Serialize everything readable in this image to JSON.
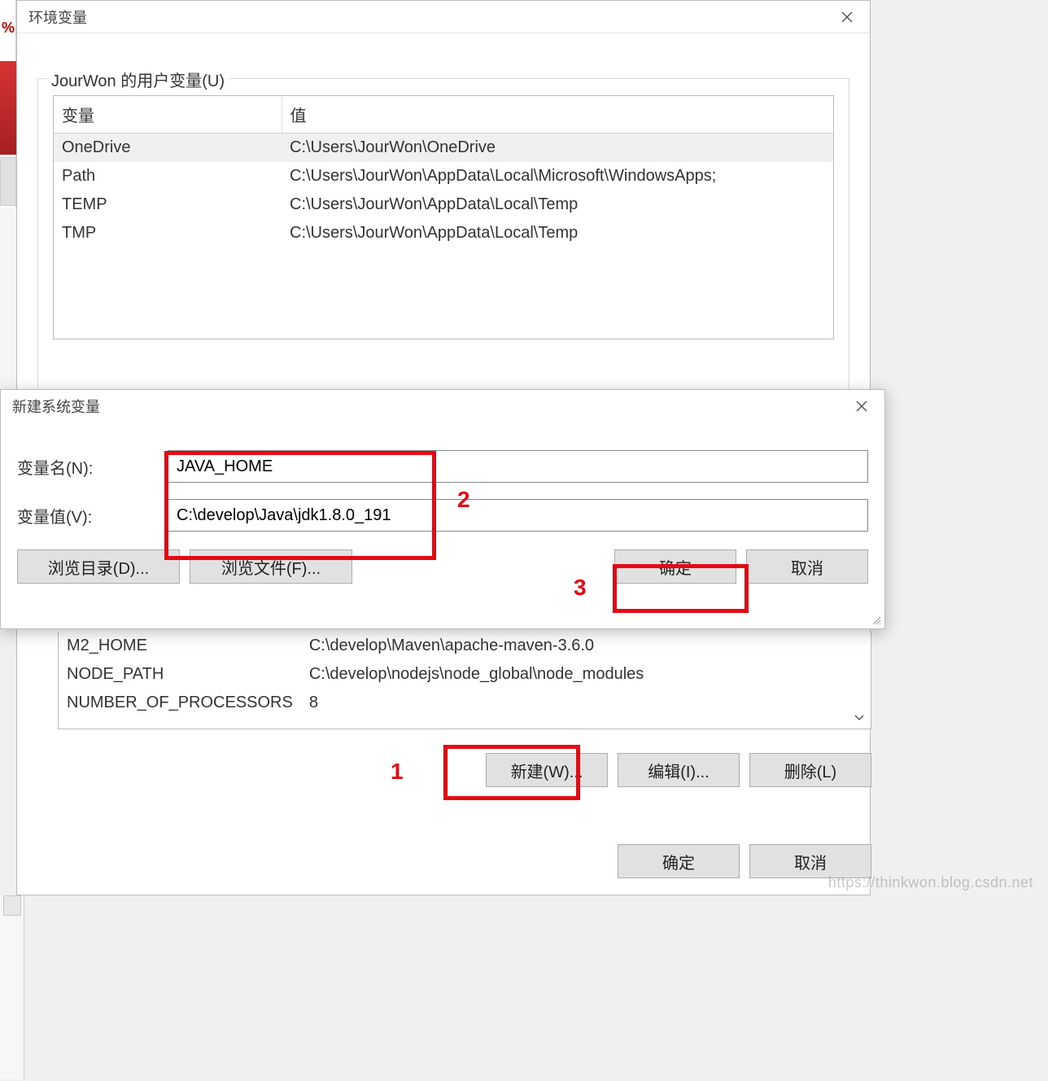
{
  "env_dialog": {
    "title": "环境变量",
    "close_tooltip": "关闭",
    "user_group_label": "JourWon 的用户变量(U)",
    "columns": {
      "name": "变量",
      "value": "值"
    },
    "user_rows": [
      {
        "name": "OneDrive",
        "value": "C:\\Users\\JourWon\\OneDrive",
        "selected": true
      },
      {
        "name": "Path",
        "value": "C:\\Users\\JourWon\\AppData\\Local\\Microsoft\\WindowsApps;",
        "selected": false
      },
      {
        "name": "TEMP",
        "value": "C:\\Users\\JourWon\\AppData\\Local\\Temp",
        "selected": false
      },
      {
        "name": "TMP",
        "value": "C:\\Users\\JourWon\\AppData\\Local\\Temp",
        "selected": false
      }
    ],
    "sys_rows_fragment": [
      {
        "name": "M2_HOME",
        "value": "C:\\develop\\Maven\\apache-maven-3.6.0"
      },
      {
        "name": "NODE_PATH",
        "value": "C:\\develop\\nodejs\\node_global\\node_modules"
      },
      {
        "name": "NUMBER_OF_PROCESSORS",
        "value": "8"
      }
    ],
    "sys_buttons": {
      "new": "新建(W)...",
      "edit": "编辑(I)...",
      "delete": "删除(L)"
    },
    "foot_buttons": {
      "ok": "确定",
      "cancel": "取消"
    }
  },
  "new_var": {
    "title": "新建系统变量",
    "name_label": "变量名(N):",
    "value_label": "变量值(V):",
    "name_value": "JAVA_HOME",
    "value_value": "C:\\develop\\Java\\jdk1.8.0_191",
    "browse_dir": "浏览目录(D)...",
    "browse_file": "浏览文件(F)...",
    "ok": "确定",
    "cancel": "取消"
  },
  "annotations": {
    "label1": "1",
    "label2": "2",
    "label3": "3"
  },
  "watermark": "https://thinkwon.blog.csdn.net",
  "truncated_left_pct": "%"
}
